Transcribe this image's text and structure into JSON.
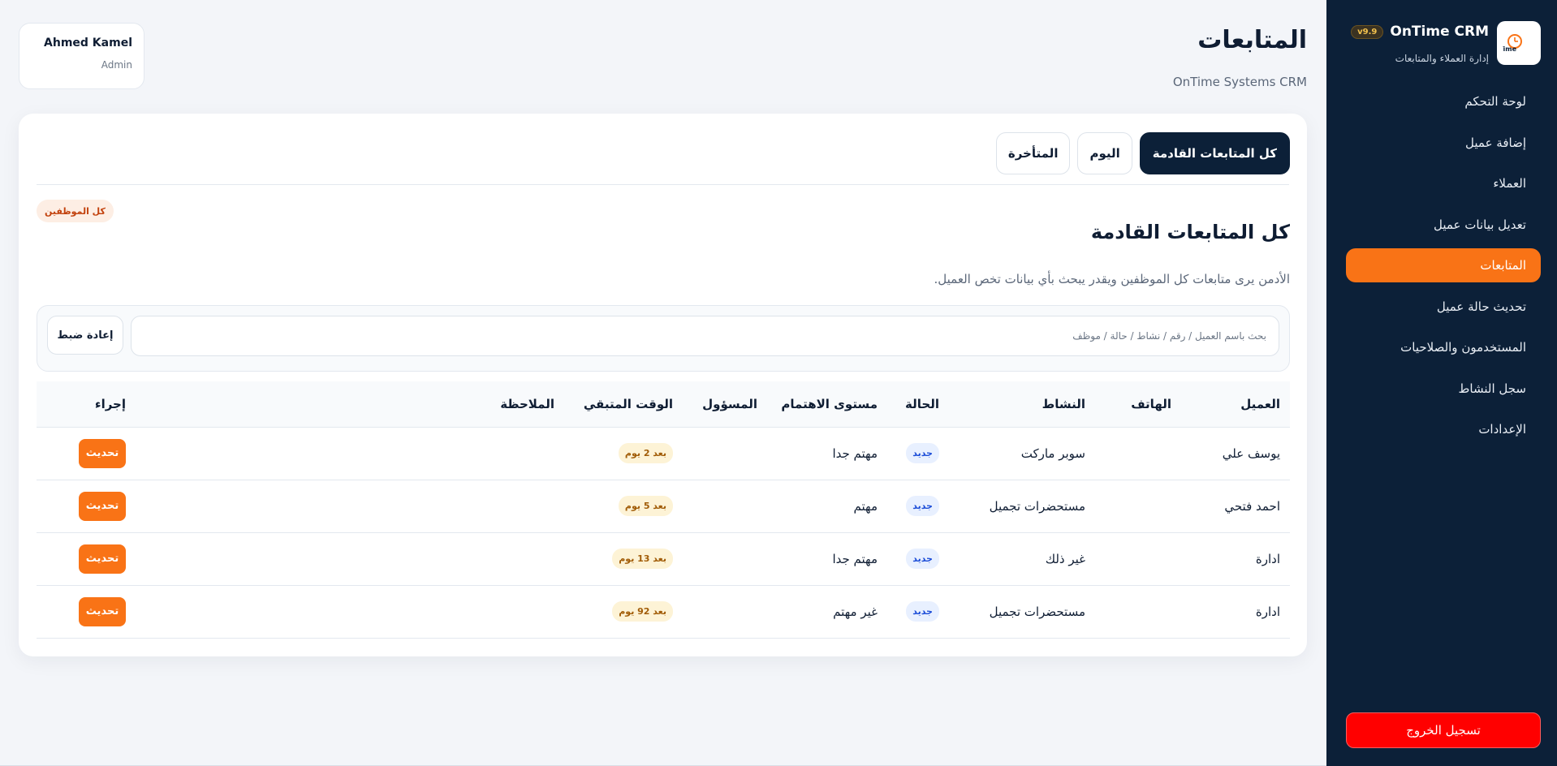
{
  "brand": {
    "name": "OnTime CRM",
    "version": "v9.9",
    "subtitle": "إدارة العملاء والمتابعات",
    "logo_text": "Time"
  },
  "sidebar": {
    "items": [
      {
        "label": "لوحة التحكم",
        "active": false
      },
      {
        "label": "إضافة عميل",
        "active": false
      },
      {
        "label": "العملاء",
        "active": false
      },
      {
        "label": "تعديل بيانات عميل",
        "active": false
      },
      {
        "label": "المتابعات",
        "active": true
      },
      {
        "label": "تحديث حالة عميل",
        "active": false
      },
      {
        "label": "المستخدمون والصلاحيات",
        "active": false
      },
      {
        "label": "سجل النشاط",
        "active": false
      },
      {
        "label": "الإعدادات",
        "active": false
      }
    ],
    "logout_label": "تسجيل الخروج"
  },
  "header": {
    "title": "المتابعات",
    "subtitle": "OnTime Systems CRM"
  },
  "user": {
    "name": "Ahmed Kamel",
    "role": "Admin"
  },
  "tabs": [
    {
      "label": "كل المتابعات القادمة",
      "active": true
    },
    {
      "label": "اليوم",
      "active": false
    },
    {
      "label": "المتأخرة",
      "active": false
    }
  ],
  "section": {
    "badge": "كل الموظفين",
    "title": "كل المتابعات القادمة",
    "description": "الأدمن يرى متابعات كل الموظفين ويقدر يبحث بأي بيانات تخص العميل."
  },
  "search": {
    "placeholder": "بحث باسم العميل / رقم / نشاط / حالة / موظف",
    "value": "",
    "reset_label": "إعادة ضبط"
  },
  "table": {
    "columns": [
      "العميل",
      "الهاتف",
      "النشاط",
      "الحالة",
      "مستوى الاهتمام",
      "المسؤول",
      "الوقت المتبقي",
      "الملاحظة",
      "إجراء"
    ],
    "action_label": "تحديث",
    "rows": [
      {
        "client": "يوسف علي",
        "phone": "",
        "activity": "سوبر ماركت",
        "status": "جديد",
        "interest": "مهتم جدا",
        "owner": "",
        "remaining": "بعد 2 يوم",
        "note": ""
      },
      {
        "client": "احمد فتحي",
        "phone": "",
        "activity": "مستحضرات تجميل",
        "status": "جديد",
        "interest": "مهتم",
        "owner": "",
        "remaining": "بعد 5 يوم",
        "note": ""
      },
      {
        "client": "ادارة",
        "phone": "",
        "activity": "غير ذلك",
        "status": "جديد",
        "interest": "مهتم جدا",
        "owner": "",
        "remaining": "بعد 13 يوم",
        "note": ""
      },
      {
        "client": "ادارة",
        "phone": "",
        "activity": "مستحضرات تجميل",
        "status": "جديد",
        "interest": "غير مهتم",
        "owner": "",
        "remaining": "بعد 92 يوم",
        "note": ""
      }
    ]
  },
  "colors": {
    "sidebar_bg": "#0c2038",
    "accent": "#f97316",
    "logout": "#ff0000",
    "status_blue": "#1d4ed8"
  }
}
